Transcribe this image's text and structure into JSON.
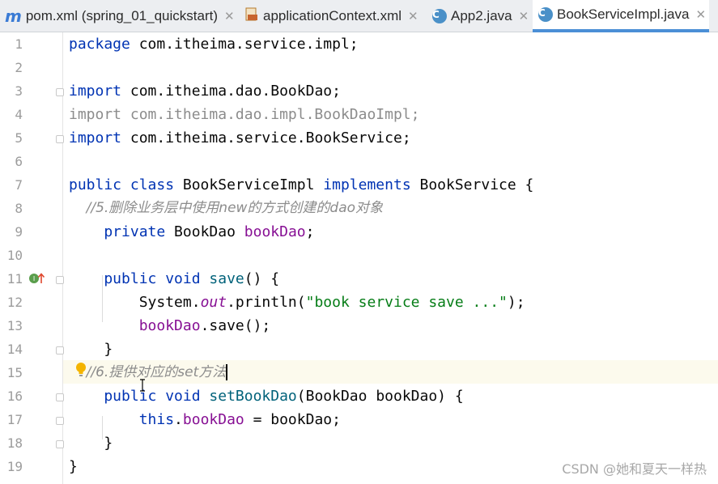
{
  "tabs": [
    {
      "label": "pom.xml (spring_01_quickstart)",
      "icon": "maven-icon",
      "active": false
    },
    {
      "label": "applicationContext.xml",
      "icon": "xml-file-icon",
      "active": false
    },
    {
      "label": "App2.java",
      "icon": "java-class-icon",
      "active": false
    },
    {
      "label": "BookServiceImpl.java",
      "icon": "java-class-icon",
      "active": true
    }
  ],
  "line_numbers": [
    "1",
    "2",
    "3",
    "4",
    "5",
    "6",
    "7",
    "8",
    "9",
    "10",
    "11",
    "12",
    "13",
    "14",
    "15",
    "16",
    "17",
    "18",
    "19"
  ],
  "code": {
    "l1_kw": "package",
    "l1_rest": " com.itheima.service.impl;",
    "l3_kw": "import",
    "l3_rest": " com.itheima.dao.BookDao;",
    "l4_text": "import com.itheima.dao.impl.BookDaoImpl;",
    "l5_kw": "import",
    "l5_rest": " com.itheima.service.BookService;",
    "l7_kw1": "public class",
    "l7_name": " BookServiceImpl ",
    "l7_kw2": "implements",
    "l7_rest": " BookService {",
    "l8_comment": "    //5.删除业务层中使用new的方式创建的dao对象",
    "l9_kw": "    private",
    "l9_type": " BookDao ",
    "l9_field": "bookDao",
    "l9_end": ";",
    "l11_kw": "    public void",
    "l11_fn": " save",
    "l11_rest": "() {",
    "l12_a": "        System.",
    "l12_out": "out",
    "l12_b": ".println(",
    "l12_str": "\"book service save ...\"",
    "l12_c": ");",
    "l13_field": "        bookDao",
    "l13_rest": ".save();",
    "l14": "    }",
    "l15_comment": "    //6.提供对应的set方法",
    "l16_kw": "    public void",
    "l16_fn": " setBookDao",
    "l16_rest": "(BookDao bookDao) {",
    "l17_kw": "        this",
    "l17_dot": ".",
    "l17_field": "bookDao",
    "l17_rest": " = bookDao;",
    "l18": "    }",
    "l19": "}"
  },
  "watermark": "CSDN @她和夏天一样热",
  "colors": {
    "keyword": "#0033b3",
    "comment": "#8c8c8c",
    "field": "#871094",
    "method": "#00627a",
    "string": "#067d17",
    "active_tab_underline": "#4b8fd6"
  }
}
